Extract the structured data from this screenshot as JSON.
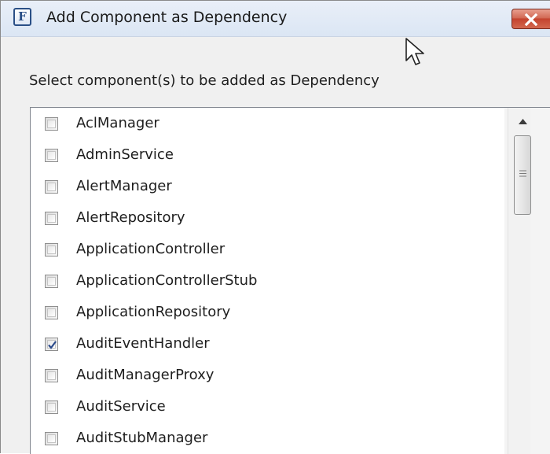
{
  "window": {
    "title": "Add Component as Dependency",
    "app_icon_glyph": "F",
    "close_icon": "close-x-icon"
  },
  "dialog": {
    "instruction": "Select component(s) to be added as Dependency"
  },
  "components": [
    {
      "label": "AclManager",
      "checked": false
    },
    {
      "label": "AdminService",
      "checked": false
    },
    {
      "label": "AlertManager",
      "checked": false
    },
    {
      "label": "AlertRepository",
      "checked": false
    },
    {
      "label": "ApplicationController",
      "checked": false
    },
    {
      "label": "ApplicationControllerStub",
      "checked": false
    },
    {
      "label": "ApplicationRepository",
      "checked": false
    },
    {
      "label": "AuditEventHandler",
      "checked": true
    },
    {
      "label": "AuditManagerProxy",
      "checked": false
    },
    {
      "label": "AuditService",
      "checked": false
    },
    {
      "label": "AuditStubManager",
      "checked": false
    }
  ],
  "colors": {
    "close_button": "#c4432e",
    "check_mark": "#2b4a8a"
  }
}
